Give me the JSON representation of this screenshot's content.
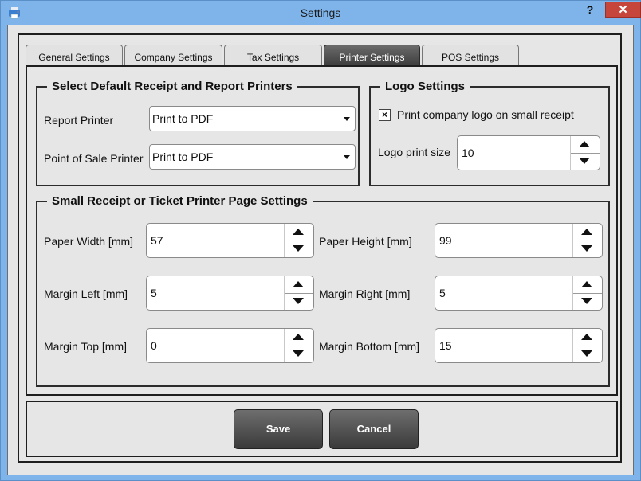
{
  "window": {
    "title": "Settings",
    "help_label": "?",
    "close_label": "✕"
  },
  "tabs": [
    {
      "label": "General Settings",
      "active": false
    },
    {
      "label": "Company Settings",
      "active": false
    },
    {
      "label": "Tax Settings",
      "active": false
    },
    {
      "label": "Printer Settings",
      "active": true
    },
    {
      "label": "POS Settings",
      "active": false
    }
  ],
  "printers_group": {
    "title": "Select Default Receipt and Report Printers",
    "report_printer_label": "Report Printer",
    "report_printer_value": "Print to PDF",
    "pos_printer_label": "Point of Sale Printer",
    "pos_printer_value": "Print to PDF"
  },
  "logo_group": {
    "title": "Logo Settings",
    "print_logo_checked": true,
    "print_logo_mark": "×",
    "print_logo_label": "Print company logo on small receipt",
    "logo_size_label": "Logo print size",
    "logo_size_value": "10"
  },
  "page_group": {
    "title": "Small Receipt or Ticket Printer Page Settings",
    "fields": {
      "paper_width": {
        "label": "Paper Width [mm]",
        "value": "57"
      },
      "paper_height": {
        "label": "Paper Height [mm]",
        "value": "99"
      },
      "margin_left": {
        "label": "Margin Left [mm]",
        "value": "5"
      },
      "margin_right": {
        "label": "Margin Right [mm]",
        "value": "5"
      },
      "margin_top": {
        "label": "Margin Top [mm]",
        "value": "0"
      },
      "margin_bottom": {
        "label": "Margin Bottom [mm]",
        "value": "15"
      }
    }
  },
  "buttons": {
    "save": "Save",
    "cancel": "Cancel"
  },
  "colors": {
    "titlebar": "#7eb4ea",
    "close": "#c7463b",
    "active_tab": "#4a4a4a",
    "client": "#e6e6e6"
  }
}
